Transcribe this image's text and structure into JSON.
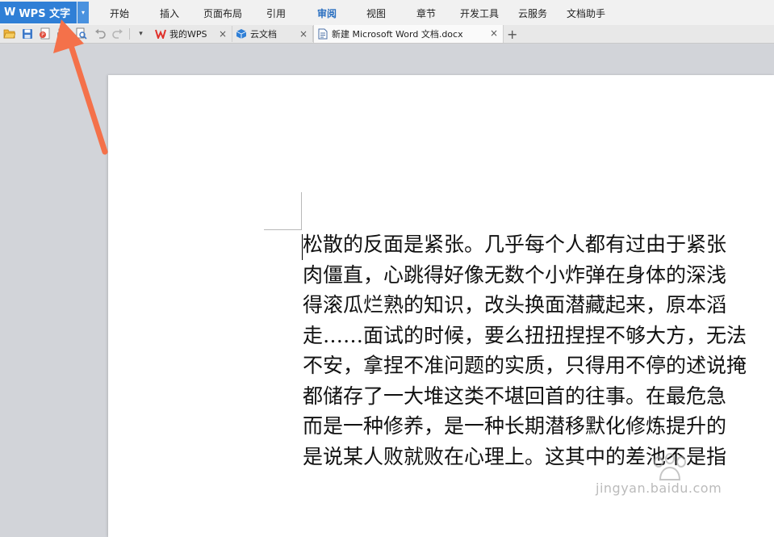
{
  "app": {
    "logo_glyph": "W",
    "name": "WPS 文字",
    "dropdown_glyph": "▾",
    "accent_color": "#2f7fd6"
  },
  "menu": {
    "items": [
      "开始",
      "插入",
      "页面布局",
      "引用",
      "审阅",
      "视图",
      "章节",
      "开发工具",
      "云服务",
      "文档助手"
    ],
    "active": "审阅"
  },
  "quick_access": {
    "icons": [
      "open-folder-icon",
      "save-icon",
      "export-pdf-icon",
      "print-icon",
      "print-preview-icon",
      "undo-icon",
      "redo-icon"
    ],
    "more_glyph": "▾"
  },
  "tabs": [
    {
      "label": "我的WPS",
      "icon": "wps-logo-icon",
      "close": "×"
    },
    {
      "label": "云文档",
      "icon": "cloud-cube-icon",
      "close": "×"
    },
    {
      "label": "新建 Microsoft Word 文档.docx",
      "icon": "document-icon",
      "close": "×"
    }
  ],
  "new_tab_glyph": "+",
  "document": {
    "lines": [
      "松散的反面是紧张。几乎每个人都有过由于紧张",
      "肉僵直，心跳得好像无数个小炸弹在身体的深浅",
      "得滚瓜烂熟的知识，改头换面潜藏起来，原本滔",
      "走……面试的时候，要么扭扭捏捏不够大方，无法",
      "不安，拿捏不准问题的实质，只得用不停的述说掩",
      "都储存了一大堆这类不堪回首的往事。在最危急",
      "而是一种修养，是一种长期潜移默化修炼提升的",
      "是说某人败就败在心理上。这其中的差池不是指"
    ]
  },
  "watermark": "jingyan.baidu.com",
  "annotation": {
    "arrow_color": "#f4714a"
  }
}
